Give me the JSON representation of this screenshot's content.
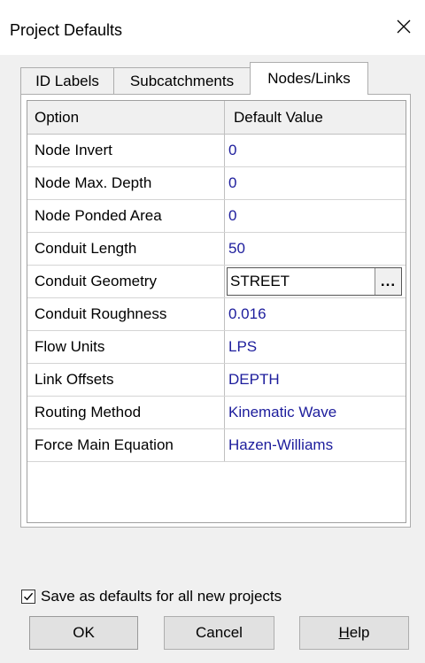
{
  "window": {
    "title": "Project Defaults",
    "close_icon": "close-icon"
  },
  "tabs": [
    {
      "label": "ID Labels"
    },
    {
      "label": "Subcatchments"
    },
    {
      "label": "Nodes/Links",
      "active": true
    }
  ],
  "grid": {
    "columns": [
      "Option",
      "Default Value"
    ],
    "rows": [
      {
        "option": "Node Invert",
        "value": "0"
      },
      {
        "option": "Node Max. Depth",
        "value": "0"
      },
      {
        "option": "Node Ponded Area",
        "value": "0"
      },
      {
        "option": "Conduit Length",
        "value": "50"
      },
      {
        "option": "Conduit Geometry",
        "value": "STREET",
        "button": "..."
      },
      {
        "option": "Conduit Roughness",
        "value": "0.016"
      },
      {
        "option": "Flow Units",
        "value": "LPS"
      },
      {
        "option": "Link Offsets",
        "value": "DEPTH"
      },
      {
        "option": "Routing Method",
        "value": "Kinematic Wave"
      },
      {
        "option": "Force Main Equation",
        "value": "Hazen-Williams"
      }
    ]
  },
  "save_defaults": {
    "label": "Save as defaults for all new projects",
    "checked": true
  },
  "buttons": {
    "ok": "OK",
    "cancel": "Cancel",
    "help_mnemonic": "H",
    "help_rest": "elp"
  }
}
